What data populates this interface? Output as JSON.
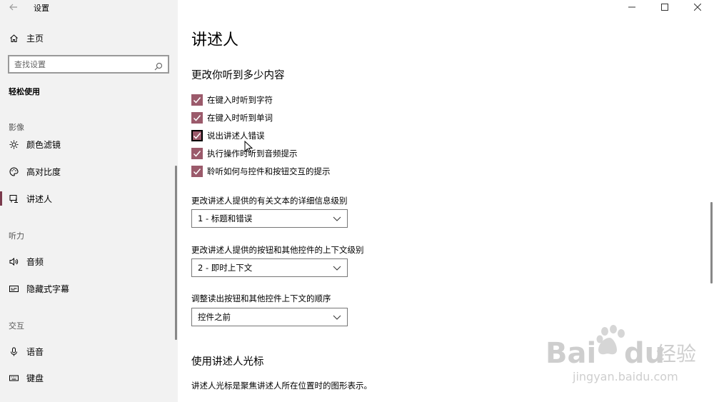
{
  "window": {
    "title": "设置"
  },
  "sidebar": {
    "home": "主页",
    "search": {
      "placeholder": "查找设置"
    },
    "section": "轻松使用",
    "groups": [
      {
        "label": "影像"
      },
      {
        "label": "听力"
      },
      {
        "label": "交互"
      }
    ],
    "items": [
      {
        "label": "颜色滤镜",
        "icon": "sun-icon"
      },
      {
        "label": "高对比度",
        "icon": "palette-icon"
      },
      {
        "label": "讲述人",
        "icon": "narrator-icon",
        "active": true
      },
      {
        "label": "音频",
        "icon": "speaker-icon"
      },
      {
        "label": "隐藏式字幕",
        "icon": "captions-icon"
      },
      {
        "label": "语音",
        "icon": "microphone-icon"
      },
      {
        "label": "键盘",
        "icon": "keyboard-icon"
      }
    ]
  },
  "main": {
    "title": "讲述人",
    "section1": {
      "title": "更改你听到多少内容",
      "checkboxes": [
        {
          "label": "在键入时听到字符",
          "checked": true
        },
        {
          "label": "在键入时听到单词",
          "checked": true
        },
        {
          "label": "说出讲述人错误",
          "checked": true,
          "focused": true
        },
        {
          "label": "执行操作时听到音频提示",
          "checked": true
        },
        {
          "label": "聆听如何与控件和按钮交互的提示",
          "checked": true
        }
      ],
      "dropdowns": [
        {
          "label": "更改讲述人提供的有关文本的详细信息级别",
          "value": "1 - 标题和错误"
        },
        {
          "label": "更改讲述人提供的按钮和其他控件的上下文级别",
          "value": "2 - 即时上下文"
        },
        {
          "label": "调整读出按钮和其他控件上下文的顺序",
          "value": "控件之前"
        }
      ]
    },
    "section2": {
      "title": "使用讲述人光标",
      "description": "讲述人光标是聚焦讲述人所在位置时的图形表示。"
    }
  },
  "watermark": {
    "brand": "Bai",
    "brand2": "du",
    "cn": "经验",
    "url": "jingyan.baidu.com"
  },
  "colors": {
    "accent": "#9b5a6b",
    "sidebar_bg": "#f2f2f2",
    "active_bar": "#7a3a4c"
  }
}
